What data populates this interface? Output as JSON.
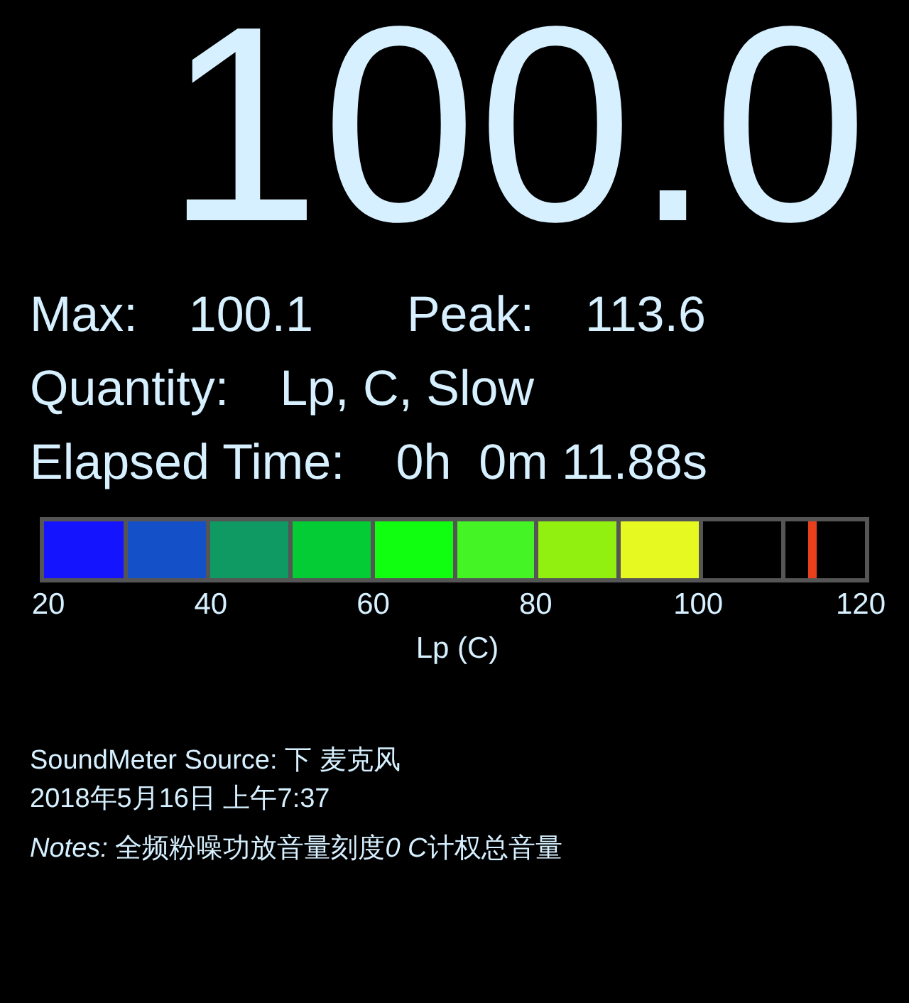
{
  "reading": "100.0",
  "stats": [
    {
      "label": "Max:",
      "value": "100.1"
    },
    {
      "label": "Peak:",
      "value": "113.6"
    }
  ],
  "quantity": {
    "label": "Quantity:",
    "value": "Lp, C, Slow"
  },
  "elapsed": {
    "label": "Elapsed Time:",
    "value": "0h  0m 11.88s"
  },
  "meter": {
    "level": 0.8,
    "peak_marker": {
      "level": 0.936
    },
    "ticks": [
      "20",
      "40",
      "60",
      "80",
      "100",
      "120"
    ],
    "axis_label": "Lp (C)"
  },
  "info": {
    "source": "SoundMeter Source: 下 麦克风",
    "date": "2018年5月16日 上午7:37",
    "notes": {
      "label": "Notes:",
      "parts": [
        {
          "text": "全频粉噪功放音量刻度",
          "italic": false
        },
        {
          "text": "0 C",
          "italic": true
        },
        {
          "text": "计权总音量",
          "italic": false
        }
      ]
    }
  }
}
